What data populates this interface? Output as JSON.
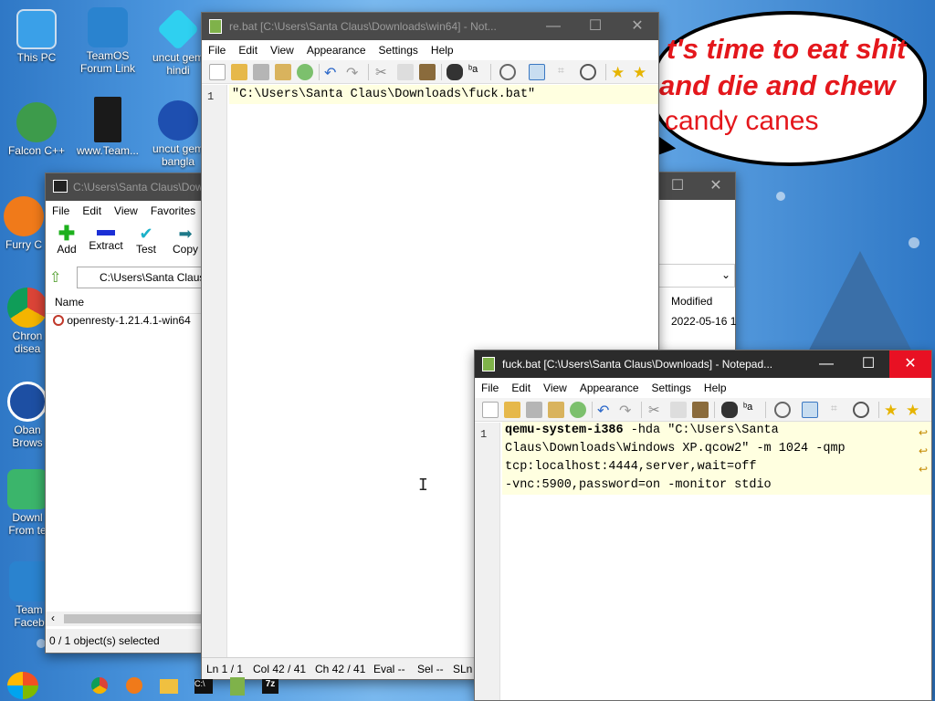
{
  "desktop": {
    "icons": [
      {
        "label": "This PC",
        "icon": "monitor-icon"
      },
      {
        "label": "TeamOS\nForum Link",
        "icon": "gear-icon"
      },
      {
        "label": "uncut gem\nhindi",
        "icon": "diamond-icon"
      },
      {
        "label": "Falcon C++",
        "icon": "recycle-icon"
      },
      {
        "label": "www.Team...",
        "icon": "book-icon"
      },
      {
        "label": "uncut gem\nbangla",
        "icon": "number-icon"
      },
      {
        "label": "Furry C",
        "icon": "firefox-icon"
      },
      {
        "label": "Chron\ndisea",
        "icon": "chrome-icon"
      },
      {
        "label": "Oban\nBrows",
        "icon": "obama-icon"
      },
      {
        "label": "Downl\nFrom te",
        "icon": "folder-icon"
      },
      {
        "label": "Team\nFaceb",
        "icon": "gear-icon"
      }
    ],
    "bubble_lines": [
      "t's time to eat shit",
      "and die and chew",
      "candy canes"
    ]
  },
  "seven_zip": {
    "title": "C:\\Users\\Santa Claus\\Dow",
    "menu": [
      "File",
      "Edit",
      "View",
      "Favorites"
    ],
    "toolbar": [
      {
        "label": "Add",
        "icon": "plus-icon"
      },
      {
        "label": "Extract",
        "icon": "minus-icon"
      },
      {
        "label": "Test",
        "icon": "check-icon"
      },
      {
        "label": "Copy",
        "icon": "arrow-right-icon"
      }
    ],
    "path": "C:\\Users\\Santa Claus",
    "column_name": "Name",
    "column_modified": "Modified",
    "files": [
      {
        "name": "openresty-1.21.4.1-win64",
        "modified": "2022-05-16 1"
      }
    ],
    "status": "0 / 1 object(s) selected"
  },
  "notepad_back": {
    "title": "re.bat [C:\\Users\\Santa Claus\\Downloads\\win64] - Not...",
    "menu": [
      "File",
      "Edit",
      "View",
      "Appearance",
      "Settings",
      "Help"
    ],
    "line_no": "1",
    "code": "\"C:\\Users\\Santa Claus\\Downloads\\fuck.bat\"",
    "status": {
      "ln": "Ln 1 / 1",
      "col": "Col 42 / 41",
      "ch": "Ch 42 / 41",
      "eval": "Eval --",
      "sel": "Sel --",
      "sln": "SLn"
    }
  },
  "notepad_front": {
    "title": "fuck.bat [C:\\Users\\Santa Claus\\Downloads] - Notepad...",
    "menu": [
      "File",
      "Edit",
      "View",
      "Appearance",
      "Settings",
      "Help"
    ],
    "line_no": "1",
    "code_bold": "qemu-system-i386",
    "code_lines": [
      " -hda \"C:\\Users\\Santa",
      "Claus\\Downloads\\Windows XP.qcow2\" -m 1024 -qmp",
      "tcp:localhost:4444,server,wait=off",
      "-vnc:5900,password=on -monitor stdio"
    ]
  },
  "taskbar": {
    "items": [
      "start-icon",
      "chrome-icon",
      "firefox-icon",
      "explorer-icon",
      "cmd-icon",
      "notepad-icon",
      "7zip-icon"
    ]
  }
}
